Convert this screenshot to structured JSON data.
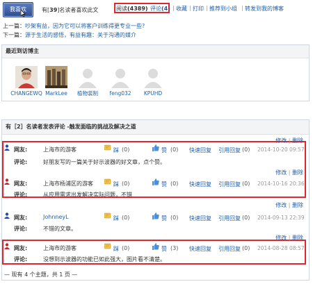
{
  "top": {
    "like_button": "我喜欢",
    "liked_prefix": "有[",
    "liked_count": "39",
    "liked_suffix": "]名读者喜欢此文",
    "read_label": "阅读",
    "read_count": "(4389)",
    "comment_label": "评论",
    "comment_count": "(4)",
    "links": [
      "收藏",
      "打印",
      "推荐到小组",
      "转发到我的博客"
    ]
  },
  "nav": {
    "prev_label": "上一篇：",
    "prev_title": "吵架有益，因为它可以将客户训练得更专业一些?",
    "next_label": "下一篇：",
    "next_title": "源于生活的感悟，有益有趣：关于沟通的媒介"
  },
  "visitors": {
    "title": "最近到访博主",
    "items": [
      {
        "name": "CHANGEWQ",
        "photo": true
      },
      {
        "name": "MarkLee",
        "photo": true
      },
      {
        "name": "植物装制",
        "photo": false
      },
      {
        "name": "feng032",
        "photo": false
      },
      {
        "name": "KPUHD",
        "photo": false
      }
    ]
  },
  "comments": {
    "header": "有［2］名读者发表评论 -触发面临的挑战及解决之道",
    "user_label": "网友:",
    "comment_label": "评论:",
    "edit": "修改",
    "delete": "删除",
    "quick_reply": "快速回复",
    "quote_reply": "引用回复",
    "dislike": "踩",
    "like": "赞",
    "items": [
      {
        "user": "上海市的游客",
        "text": "好朋友写的一篇关于好示波器的好文章，点个赞。",
        "dislikes": "(0)",
        "likes": "(0)",
        "replies": "(0)",
        "time": "2014-10-20 09:57",
        "color": "#2a4aa0"
      },
      {
        "user": "上海市杨浦区的游客",
        "text": "从应用需求出发解决实际问题，不错",
        "dislikes": "(0)",
        "likes": "(0)",
        "replies": "(0)",
        "time": "2014-10-16 20:36",
        "color": "#c0282e"
      },
      {
        "user": "JohnneyL",
        "text": "不错的文章。",
        "dislikes": "(0)",
        "likes": "(0)",
        "replies": "(0)",
        "time": "2014-09-13 22:39",
        "color": "#2a4aa0"
      },
      {
        "user": "上海市的游客",
        "text": "没想到示波器的功能已如此强大，图片看不清楚。",
        "dislikes": "(0)",
        "likes": "(3)",
        "replies": "(0)",
        "time": "2014-08-28 08:57",
        "color": "#c0282e"
      }
    ],
    "footer": "— 现有 4 个主题，共 1 页 —"
  }
}
